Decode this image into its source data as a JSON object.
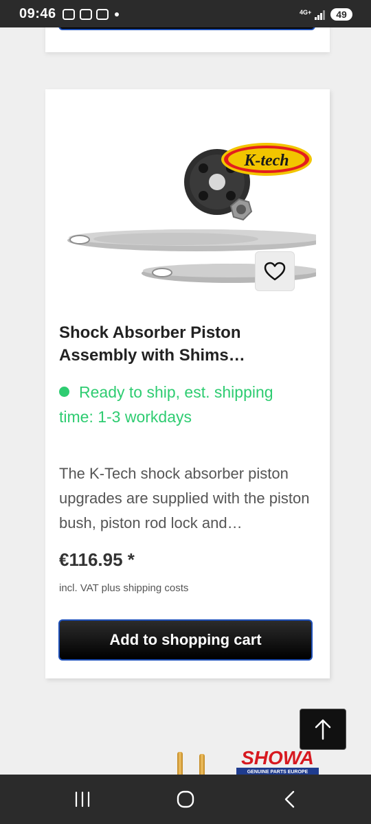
{
  "status_bar": {
    "time": "09:46",
    "network": "4G+",
    "battery": "49",
    "icons": [
      "notification-icon",
      "screenshot-icon",
      "notification-icon"
    ]
  },
  "product": {
    "brand_logo_text": "K-tech",
    "title": "Shock Absorber Piston Assembly with Shims…",
    "stock": "Ready to ship, est. shipping time: 1-3 workdays",
    "description": "The K-Tech shock absorber piston upgrades are supplied with the piston bush, piston rod lock and…",
    "price": "€116.95 *",
    "vat_note": "incl. VAT plus shipping costs",
    "add_to_cart_label": "Add to shopping cart"
  },
  "next_product": {
    "brand_logo_text": "SHOWA",
    "brand_subtext": "GENUINE PARTS EUROPE"
  },
  "colors": {
    "stock_green": "#2ecc71",
    "button_border": "#1d4fb8",
    "button_bg": "#000000"
  }
}
